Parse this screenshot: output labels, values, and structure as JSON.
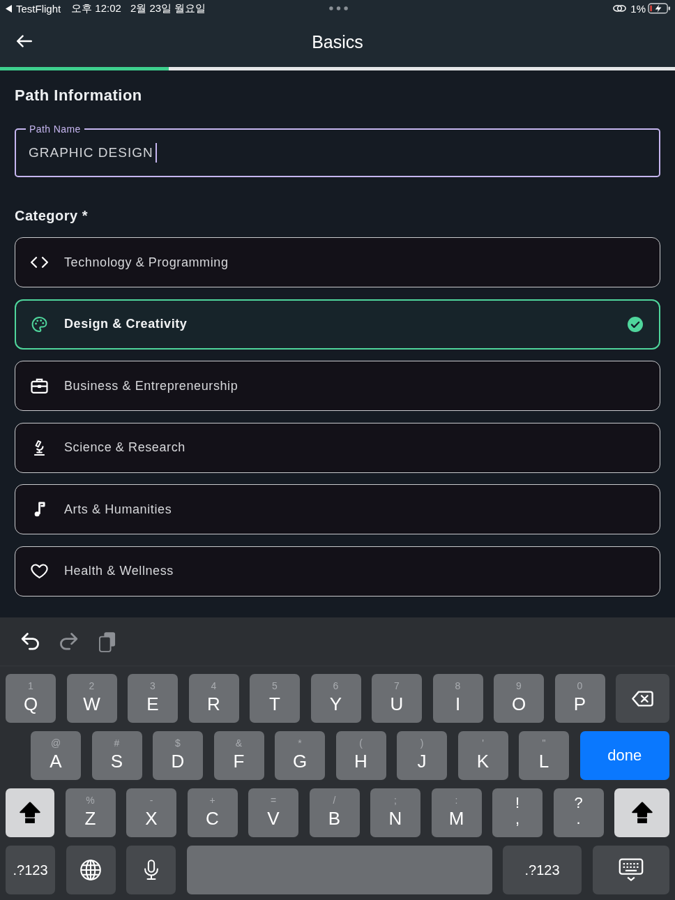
{
  "status_bar": {
    "app": "TestFlight",
    "time": "오후 12:02",
    "date": "2월 23일 월요일",
    "battery": "1%"
  },
  "header": {
    "title": "Basics",
    "progress": {
      "level": 0.25
    }
  },
  "path_information": {
    "title": "Path Information",
    "path_name": {
      "label": "Path Name",
      "value": "GRAPHIC DESIGN",
      "focused": true
    }
  },
  "category": {
    "title": "Category *",
    "options": [
      {
        "kind": "technology",
        "label": "Technology & Programming",
        "selected": false
      },
      {
        "kind": "design",
        "label": "Design & Creativity",
        "selected": true
      },
      {
        "kind": "business",
        "label": "Business & Entrepreneurship",
        "selected": false
      },
      {
        "kind": "science",
        "label": "Science & Research",
        "selected": false
      },
      {
        "kind": "arts",
        "label": "Arts & Humanities",
        "selected": false
      },
      {
        "kind": "health",
        "label": "Health & Wellness",
        "selected": false
      }
    ]
  },
  "keyboard": {
    "toolbar": [
      {
        "kind": "undo",
        "disabled": false
      },
      {
        "kind": "redo",
        "disabled": true
      },
      {
        "kind": "paste",
        "disabled": true
      }
    ],
    "rows": [
      [
        {
          "kind": "letter",
          "hint": "1",
          "label": "Q"
        },
        {
          "kind": "letter",
          "hint": "2",
          "label": "W"
        },
        {
          "kind": "letter",
          "hint": "3",
          "label": "E"
        },
        {
          "kind": "letter",
          "hint": "4",
          "label": "R"
        },
        {
          "kind": "letter",
          "hint": "5",
          "label": "T"
        },
        {
          "kind": "letter",
          "hint": "6",
          "label": "Y"
        },
        {
          "kind": "letter",
          "hint": "7",
          "label": "U"
        },
        {
          "kind": "letter",
          "hint": "8",
          "label": "I"
        },
        {
          "kind": "letter",
          "hint": "9",
          "label": "O"
        },
        {
          "kind": "letter",
          "hint": "0",
          "label": "P"
        },
        {
          "kind": "backspace"
        }
      ],
      [
        {
          "kind": "letter",
          "hint": "@",
          "label": "A"
        },
        {
          "kind": "letter",
          "hint": "#",
          "label": "S"
        },
        {
          "kind": "letter",
          "hint": "$",
          "label": "D"
        },
        {
          "kind": "letter",
          "hint": "&",
          "label": "F"
        },
        {
          "kind": "letter",
          "hint": "*",
          "label": "G"
        },
        {
          "kind": "letter",
          "hint": "(",
          "label": "H"
        },
        {
          "kind": "letter",
          "hint": ")",
          "label": "J"
        },
        {
          "kind": "letter",
          "hint": "'",
          "label": "K"
        },
        {
          "kind": "letter",
          "hint": "\"",
          "label": "L"
        },
        {
          "kind": "done",
          "label": "done"
        }
      ],
      [
        {
          "kind": "shift",
          "on": true
        },
        {
          "kind": "letter",
          "hint": "%",
          "label": "Z"
        },
        {
          "kind": "letter",
          "hint": "-",
          "label": "X"
        },
        {
          "kind": "letter",
          "hint": "+",
          "label": "C"
        },
        {
          "kind": "letter",
          "hint": "=",
          "label": "V"
        },
        {
          "kind": "letter",
          "hint": "/",
          "label": "B"
        },
        {
          "kind": "letter",
          "hint": ";",
          "label": "N"
        },
        {
          "kind": "letter",
          "hint": ":",
          "label": "M"
        },
        {
          "kind": "punct",
          "hint": "!",
          "label": ","
        },
        {
          "kind": "punct",
          "hint": "?",
          "label": "."
        },
        {
          "kind": "shift",
          "on": true
        }
      ],
      [
        {
          "kind": "mode",
          "label": ".?123"
        },
        {
          "kind": "globe"
        },
        {
          "kind": "mic"
        },
        {
          "kind": "space"
        },
        {
          "kind": "mode",
          "label": ".?123"
        },
        {
          "kind": "dismiss"
        }
      ]
    ]
  }
}
